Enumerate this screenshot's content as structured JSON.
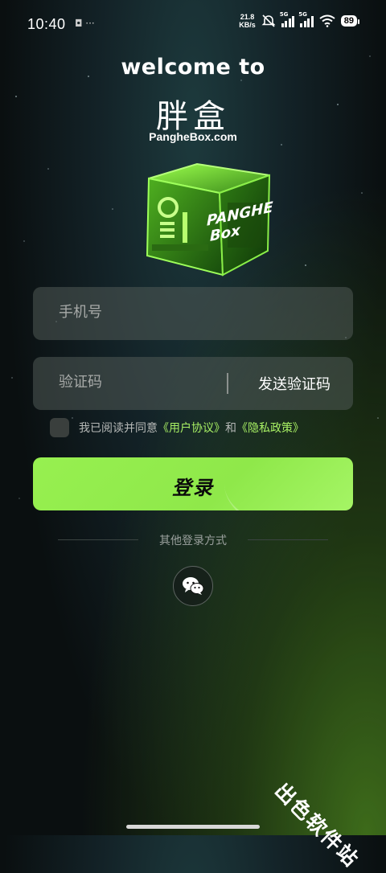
{
  "status_bar": {
    "time": "10:40",
    "left_icons": "◘ ···",
    "speed_value": "21.8",
    "speed_unit": "KB/s",
    "sim1_tag": "5G",
    "sim2_tag": "5G",
    "battery": "89"
  },
  "header": {
    "welcome": "welcome to",
    "brand_name": "胖盒",
    "brand_url": "PangheBox.com"
  },
  "cube": {
    "label_line1": "PANGHE",
    "label_line2": "Box"
  },
  "form": {
    "phone_placeholder": "手机号",
    "code_placeholder": "验证码",
    "send_code_label": "发送验证码"
  },
  "agreement": {
    "prefix": "我已阅读并同意",
    "user_agreement": "《用户协议》",
    "and": "和",
    "privacy_policy": "《隐私政策》"
  },
  "login_button": "登录",
  "other_login_label": "其他登录方式",
  "watermark": "出色软件站",
  "colors": {
    "accent": "#97f050",
    "link": "#a8f064"
  }
}
